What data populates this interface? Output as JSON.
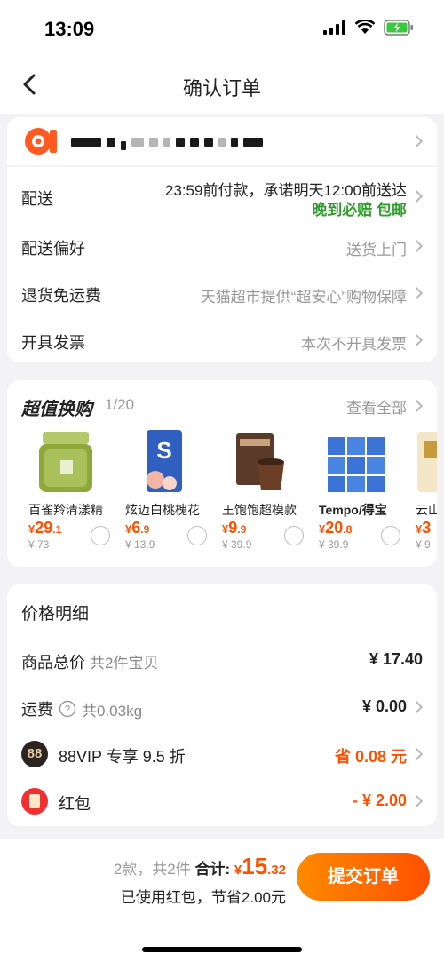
{
  "status_bar": {
    "time": "13:09"
  },
  "nav": {
    "title": "确认订单"
  },
  "delivery": {
    "shipping_label": "配送",
    "shipping_value": "23:59前付款，承诺明天12:00前送达",
    "shipping_guarantee": "晚到必赔 包邮",
    "preference_label": "配送偏好",
    "preference_value": "送货上门",
    "return_label": "退货免运费",
    "return_value": "天猫超市提供“超安心”购物保障",
    "invoice_label": "开具发票",
    "invoice_value": "本次不开具发票"
  },
  "deals": {
    "title": "超值换购",
    "count": "1/20",
    "view_all": "查看全部",
    "items": [
      {
        "name": "百雀羚清漾精",
        "price_int": "29",
        "price_dec": ".1",
        "orig": "¥ 73"
      },
      {
        "name": "炫迈白桃槐花",
        "price_int": "6",
        "price_dec": ".9",
        "orig": "¥ 13.9"
      },
      {
        "name": "王饱饱超模款",
        "price_int": "9",
        "price_dec": ".9",
        "orig": "¥ 39.9"
      },
      {
        "name": "Tempo/得宝",
        "price_int": "20",
        "price_dec": ".8",
        "orig": "¥ 39.9"
      },
      {
        "name": "云山",
        "price_int": "3",
        "price_dec": "",
        "orig": "¥ 9"
      }
    ]
  },
  "price_detail": {
    "title": "价格明细",
    "goods_label": "商品总价",
    "goods_sub": "共2件宝贝",
    "goods_amount": "¥ 17.40",
    "freight_label": "运费",
    "freight_sub": "共0.03kg",
    "freight_amount": "¥ 0.00",
    "vip_icon": "88",
    "vip_label": "88VIP 专享 9.5 折",
    "vip_amount": "省 0.08 元",
    "redpacket_label": "红包",
    "redpacket_amount": "- ¥ 2.00"
  },
  "summary": {
    "count_text": "2款，共2件",
    "total_label": "合计:",
    "total_yen": "¥",
    "total_int": "15",
    "total_dec": ".32",
    "saving_text": "已使用红包，节省2.00元",
    "submit_label": "提交订单"
  },
  "colors": {
    "accent": "#ff5000",
    "green": "#2e9d2a"
  }
}
